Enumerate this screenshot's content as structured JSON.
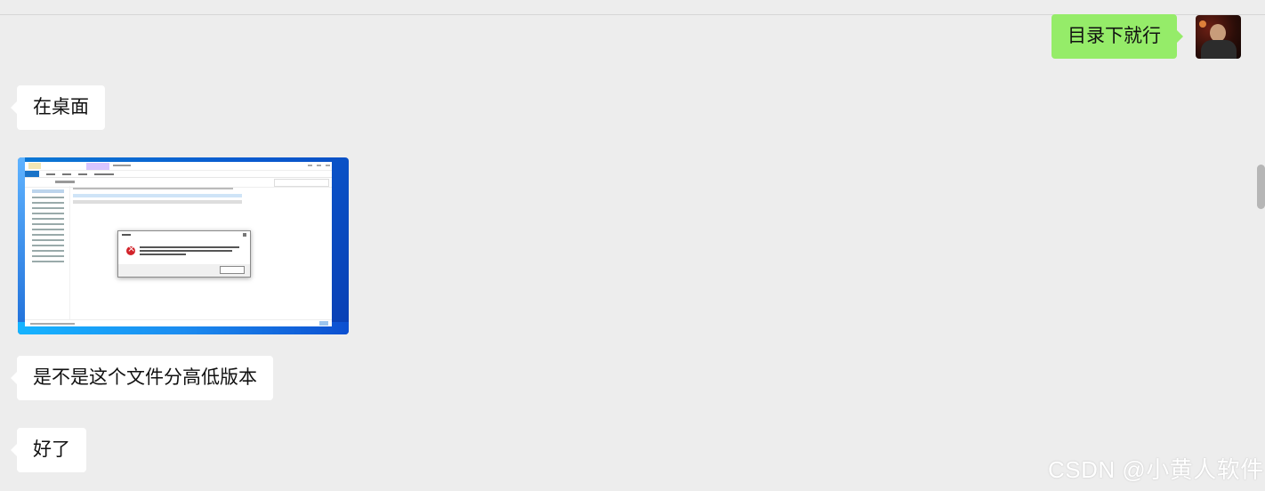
{
  "chat": {
    "messages": [
      {
        "side": "right",
        "type": "text",
        "text": "目录下就行"
      },
      {
        "side": "left",
        "type": "text",
        "text": "在桌面"
      },
      {
        "side": "left",
        "type": "image",
        "image_description": "error-dialog-screenshot"
      },
      {
        "side": "left",
        "type": "text",
        "text": "是不是这个文件分高低版本"
      },
      {
        "side": "left",
        "type": "text",
        "text": "好了"
      }
    ]
  },
  "watermark": {
    "text": "CSDN @小黄人软件"
  },
  "colors": {
    "background": "#ededed",
    "self_bubble": "#95ec69",
    "other_bubble": "#ffffff"
  },
  "icons": {
    "avatar": "user-avatar-icon",
    "error": "error-icon"
  }
}
